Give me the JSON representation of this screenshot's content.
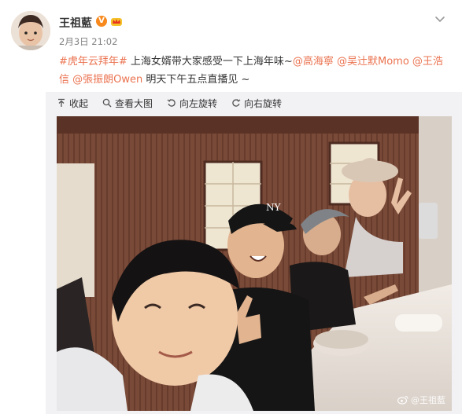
{
  "author": {
    "name": "王祖藍",
    "verified_mark": "V",
    "member_icon": "crown-icon",
    "time": "2月3日 21:02"
  },
  "post": {
    "topic": "#虎年云拜年#",
    "text_1": " 上海女婿带大家感受一下上海年味~",
    "mentions": [
      "@高海寧",
      "@吴辻默Momo",
      "@王浩信",
      "@張振朗Owen"
    ],
    "text_2": " 明天下午五点直播见 ~"
  },
  "media_toolbar": {
    "collapse": "收起",
    "view_large": "查看大图",
    "rotate_left": "向左旋转",
    "rotate_right": "向右旋转"
  },
  "photo": {
    "watermark": "@王祖藍",
    "cap_text": "NY"
  },
  "colors": {
    "link": "#eb7350",
    "verified": "#f7891d",
    "muted": "#808080"
  }
}
